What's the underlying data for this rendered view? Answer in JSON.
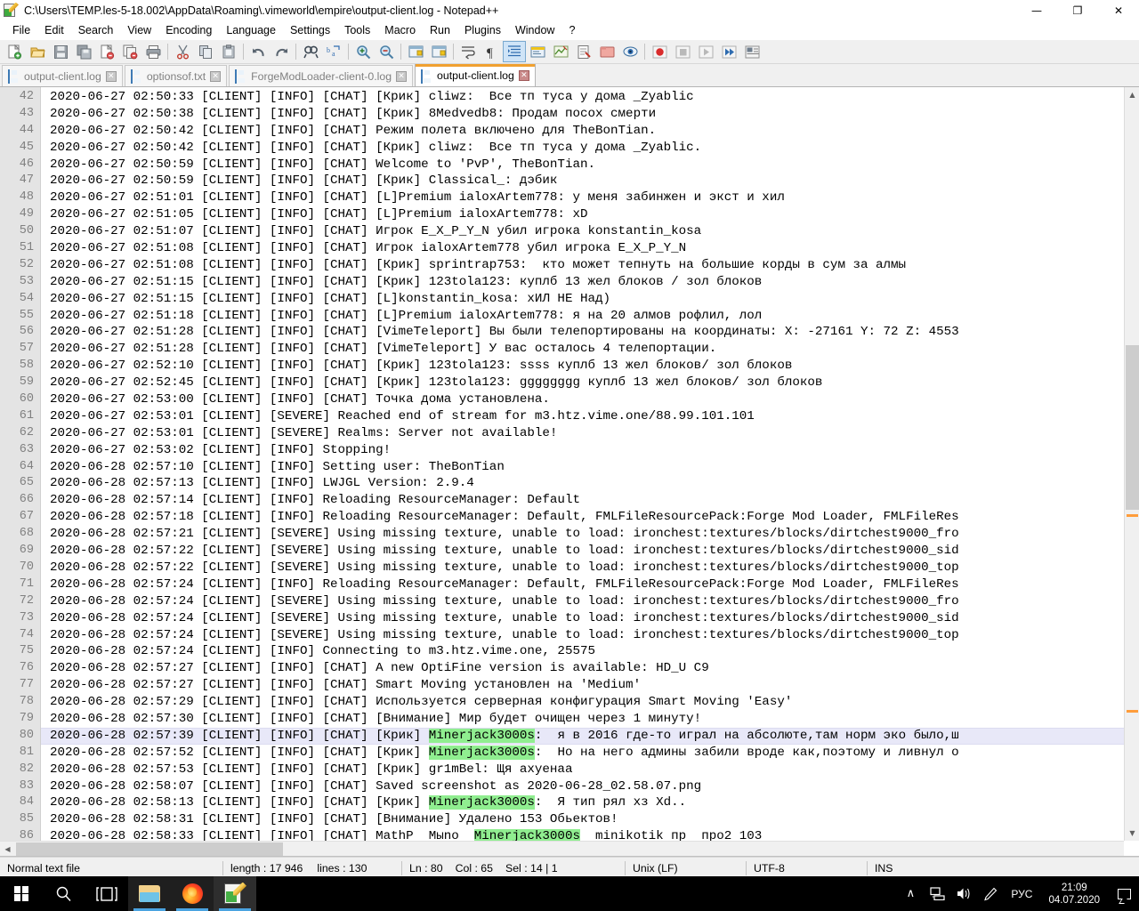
{
  "window": {
    "title": "C:\\Users\\TEMP.les-5-18.002\\AppData\\Roaming\\.vimeworld\\empire\\output-client.log - Notepad++",
    "minimize": "—",
    "maximize": "❐",
    "close": "✕"
  },
  "menu": [
    "File",
    "Edit",
    "Search",
    "View",
    "Encoding",
    "Language",
    "Settings",
    "Tools",
    "Macro",
    "Run",
    "Plugins",
    "Window",
    "?"
  ],
  "toolbar": [
    {
      "name": "new-file-icon",
      "glyph": "new"
    },
    {
      "name": "open-file-icon",
      "glyph": "open"
    },
    {
      "name": "save-icon",
      "glyph": "save"
    },
    {
      "name": "save-all-icon",
      "glyph": "saveall"
    },
    {
      "name": "close-file-icon",
      "glyph": "closefile"
    },
    {
      "name": "close-all-icon",
      "glyph": "closeall"
    },
    {
      "name": "print-icon",
      "glyph": "print"
    },
    {
      "name": "separator-1",
      "glyph": "sep"
    },
    {
      "name": "cut-icon",
      "glyph": "cut"
    },
    {
      "name": "copy-icon",
      "glyph": "copy"
    },
    {
      "name": "paste-icon",
      "glyph": "paste"
    },
    {
      "name": "separator-2",
      "glyph": "sep"
    },
    {
      "name": "undo-icon",
      "glyph": "undo"
    },
    {
      "name": "redo-icon",
      "glyph": "redo"
    },
    {
      "name": "separator-3",
      "glyph": "sep"
    },
    {
      "name": "find-icon",
      "glyph": "find"
    },
    {
      "name": "replace-icon",
      "glyph": "replace"
    },
    {
      "name": "separator-4",
      "glyph": "sep"
    },
    {
      "name": "zoom-in-icon",
      "glyph": "zoomin"
    },
    {
      "name": "zoom-out-icon",
      "glyph": "zoomout"
    },
    {
      "name": "separator-5",
      "glyph": "sep"
    },
    {
      "name": "sync-vertical-icon",
      "glyph": "syncv"
    },
    {
      "name": "sync-horizontal-icon",
      "glyph": "synch"
    },
    {
      "name": "separator-6",
      "glyph": "sep"
    },
    {
      "name": "word-wrap-icon",
      "glyph": "wrap"
    },
    {
      "name": "all-chars-icon",
      "glyph": "pilcrow"
    },
    {
      "name": "indent-guide-icon",
      "glyph": "indent"
    },
    {
      "name": "ui-user-defined-icon",
      "glyph": "udl"
    },
    {
      "name": "document-map-icon",
      "glyph": "docmap"
    },
    {
      "name": "function-list-icon",
      "glyph": "funclist"
    },
    {
      "name": "folder-workspace-icon",
      "glyph": "folderws"
    },
    {
      "name": "monitoring-icon",
      "glyph": "eye"
    },
    {
      "name": "separator-7",
      "glyph": "sep"
    },
    {
      "name": "macro-record-icon",
      "glyph": "rec"
    },
    {
      "name": "macro-stop-icon",
      "glyph": "stop"
    },
    {
      "name": "macro-play-icon",
      "glyph": "play"
    },
    {
      "name": "macro-playmany-icon",
      "glyph": "playmany"
    },
    {
      "name": "macro-save-icon",
      "glyph": "macrosave"
    }
  ],
  "tabs": [
    {
      "label": "output-client.log",
      "active": false
    },
    {
      "label": "optionsof.txt",
      "active": false
    },
    {
      "label": "ForgeModLoader-client-0.log",
      "active": false
    },
    {
      "label": "output-client.log",
      "active": true
    }
  ],
  "editor": {
    "first_line": 42,
    "current_line": 80,
    "highlight_term": "Minerjack3000s",
    "highlight_color": "#90ee90",
    "current_line_color": "#e8e8f8",
    "lines": [
      {
        "n": 42,
        "text": "2020-06-27 02:50:33 [CLIENT] [INFO] [CHAT] [Крик] cliwz:  Все тп туса у дома _Zyablic"
      },
      {
        "n": 43,
        "text": "2020-06-27 02:50:38 [CLIENT] [INFO] [CHAT] [Крик] 8Medvedb8: Продам посох смерти"
      },
      {
        "n": 44,
        "text": "2020-06-27 02:50:42 [CLIENT] [INFO] [CHAT] Режим полета включено для TheBonTian."
      },
      {
        "n": 45,
        "text": "2020-06-27 02:50:42 [CLIENT] [INFO] [CHAT] [Крик] cliwz:  Все тп туса у дома _Zyablic."
      },
      {
        "n": 46,
        "text": "2020-06-27 02:50:59 [CLIENT] [INFO] [CHAT] Welcome to 'PvP', TheBonTian."
      },
      {
        "n": 47,
        "text": "2020-06-27 02:50:59 [CLIENT] [INFO] [CHAT] [Крик] Classical_: дэбик"
      },
      {
        "n": 48,
        "text": "2020-06-27 02:51:01 [CLIENT] [INFO] [CHAT] [L]Premium ialoxArtem778: у меня забинжен и экст и хил"
      },
      {
        "n": 49,
        "text": "2020-06-27 02:51:05 [CLIENT] [INFO] [CHAT] [L]Premium ialoxArtem778: xD"
      },
      {
        "n": 50,
        "text": "2020-06-27 02:51:07 [CLIENT] [INFO] [CHAT] Игрок E_X_P_Y_N убил игрока konstantin_kosa"
      },
      {
        "n": 51,
        "text": "2020-06-27 02:51:08 [CLIENT] [INFO] [CHAT] Игрок ialoxArtem778 убил игрока E_X_P_Y_N"
      },
      {
        "n": 52,
        "text": "2020-06-27 02:51:08 [CLIENT] [INFO] [CHAT] [Крик] sprintrap753:  кто может тепнуть на большие корды в сум за алмы"
      },
      {
        "n": 53,
        "text": "2020-06-27 02:51:15 [CLIENT] [INFO] [CHAT] [Крик] 123tola123: куплб 13 жел блоков / зол блоков"
      },
      {
        "n": 54,
        "text": "2020-06-27 02:51:15 [CLIENT] [INFO] [CHAT] [L]konstantin_kosa: хИЛ НЕ Над)"
      },
      {
        "n": 55,
        "text": "2020-06-27 02:51:18 [CLIENT] [INFO] [CHAT] [L]Premium ialoxArtem778: я на 20 алмов рофлил, лол"
      },
      {
        "n": 56,
        "text": "2020-06-27 02:51:28 [CLIENT] [INFO] [CHAT] [VimeTeleport] Вы были телепортированы на координаты: X: -27161 Y: 72 Z: 4553"
      },
      {
        "n": 57,
        "text": "2020-06-27 02:51:28 [CLIENT] [INFO] [CHAT] [VimeTeleport] У вас осталось 4 телепортации."
      },
      {
        "n": 58,
        "text": "2020-06-27 02:52:10 [CLIENT] [INFO] [CHAT] [Крик] 123tola123: ssss куплб 13 жел блоков/ зол блоков"
      },
      {
        "n": 59,
        "text": "2020-06-27 02:52:45 [CLIENT] [INFO] [CHAT] [Крик] 123tola123: gggggggg куплб 13 жел блоков/ зол блоков"
      },
      {
        "n": 60,
        "text": "2020-06-27 02:53:00 [CLIENT] [INFO] [CHAT] Точка дома установлена."
      },
      {
        "n": 61,
        "text": "2020-06-27 02:53:01 [CLIENT] [SEVERE] Reached end of stream for m3.htz.vime.one/88.99.101.101"
      },
      {
        "n": 62,
        "text": "2020-06-27 02:53:01 [CLIENT] [SEVERE] Realms: Server not available!"
      },
      {
        "n": 63,
        "text": "2020-06-27 02:53:02 [CLIENT] [INFO] Stopping!"
      },
      {
        "n": 64,
        "text": "2020-06-28 02:57:10 [CLIENT] [INFO] Setting user: TheBonTian"
      },
      {
        "n": 65,
        "text": "2020-06-28 02:57:13 [CLIENT] [INFO] LWJGL Version: 2.9.4"
      },
      {
        "n": 66,
        "text": "2020-06-28 02:57:14 [CLIENT] [INFO] Reloading ResourceManager: Default"
      },
      {
        "n": 67,
        "text": "2020-06-28 02:57:18 [CLIENT] [INFO] Reloading ResourceManager: Default, FMLFileResourcePack:Forge Mod Loader, FMLFileRes"
      },
      {
        "n": 68,
        "text": "2020-06-28 02:57:21 [CLIENT] [SEVERE] Using missing texture, unable to load: ironchest:textures/blocks/dirtchest9000_fro"
      },
      {
        "n": 69,
        "text": "2020-06-28 02:57:22 [CLIENT] [SEVERE] Using missing texture, unable to load: ironchest:textures/blocks/dirtchest9000_sid"
      },
      {
        "n": 70,
        "text": "2020-06-28 02:57:22 [CLIENT] [SEVERE] Using missing texture, unable to load: ironchest:textures/blocks/dirtchest9000_top"
      },
      {
        "n": 71,
        "text": "2020-06-28 02:57:24 [CLIENT] [INFO] Reloading ResourceManager: Default, FMLFileResourcePack:Forge Mod Loader, FMLFileRes"
      },
      {
        "n": 72,
        "text": "2020-06-28 02:57:24 [CLIENT] [SEVERE] Using missing texture, unable to load: ironchest:textures/blocks/dirtchest9000_fro"
      },
      {
        "n": 73,
        "text": "2020-06-28 02:57:24 [CLIENT] [SEVERE] Using missing texture, unable to load: ironchest:textures/blocks/dirtchest9000_sid"
      },
      {
        "n": 74,
        "text": "2020-06-28 02:57:24 [CLIENT] [SEVERE] Using missing texture, unable to load: ironchest:textures/blocks/dirtchest9000_top"
      },
      {
        "n": 75,
        "text": "2020-06-28 02:57:24 [CLIENT] [INFO] Connecting to m3.htz.vime.one, 25575"
      },
      {
        "n": 76,
        "text": "2020-06-28 02:57:27 [CLIENT] [INFO] [CHAT] A new OptiFine version is available: HD_U C9"
      },
      {
        "n": 77,
        "text": "2020-06-28 02:57:27 [CLIENT] [INFO] [CHAT] Smart Moving установлен на 'Medium'"
      },
      {
        "n": 78,
        "text": "2020-06-28 02:57:29 [CLIENT] [INFO] [CHAT] Используется серверная конфигурация Smart Moving 'Easy'"
      },
      {
        "n": 79,
        "text": "2020-06-28 02:57:30 [CLIENT] [INFO] [CHAT] [Внимание] Мир будет очищен через 1 минуту!"
      },
      {
        "n": 80,
        "text": "2020-06-28 02:57:39 [CLIENT] [INFO] [CHAT] [Крик] Minerjack3000s:  я в 2016 где-то играл на абсолюте,там норм эко было,ш"
      },
      {
        "n": 81,
        "text": "2020-06-28 02:57:52 [CLIENT] [INFO] [CHAT] [Крик] Minerjack3000s:  Но на него админы забили вроде как,поэтому и ливнул о"
      },
      {
        "n": 82,
        "text": "2020-06-28 02:57:53 [CLIENT] [INFO] [CHAT] [Крик] gr1mBel: Щя ахуенаа"
      },
      {
        "n": 83,
        "text": "2020-06-28 02:58:07 [CLIENT] [INFO] [CHAT] Saved screenshot as 2020-06-28_02.58.07.png"
      },
      {
        "n": 84,
        "text": "2020-06-28 02:58:13 [CLIENT] [INFO] [CHAT] [Крик] Minerjack3000s:  Я тип рял хз Xd.."
      },
      {
        "n": 85,
        "text": "2020-06-28 02:58:31 [CLIENT] [INFO] [CHAT] [Внимание] Удалено 153 Обьектов!"
      },
      {
        "n": 86,
        "text": "2020-06-28 02:58:33 [CLIENT] [INFO] [CHAT] MathP  Mыno  Minerjack3000s  minikotik пр  про2 103"
      }
    ]
  },
  "statusbar": {
    "file_type": "Normal text file",
    "length_label": "length : 17 946",
    "lines_label": "lines : 130",
    "ln": "Ln : 80",
    "col": "Col : 65",
    "sel": "Sel : 14 | 1",
    "eol": "Unix (LF)",
    "encoding": "UTF-8",
    "insert_mode": "INS"
  },
  "taskbar": {
    "start": "start-button",
    "search": "search-icon",
    "task_view": "task-view-icon",
    "explorer": "file-explorer-icon",
    "firefox": "firefox-icon",
    "notepadpp": "notepad-plus-plus-icon",
    "chevron": "∧",
    "network": "network-icon",
    "volume": "volume-icon",
    "pen": "pen-icon",
    "language": "РУС",
    "time": "21:09",
    "date": "04.07.2020",
    "action_center": "action-center-icon"
  }
}
